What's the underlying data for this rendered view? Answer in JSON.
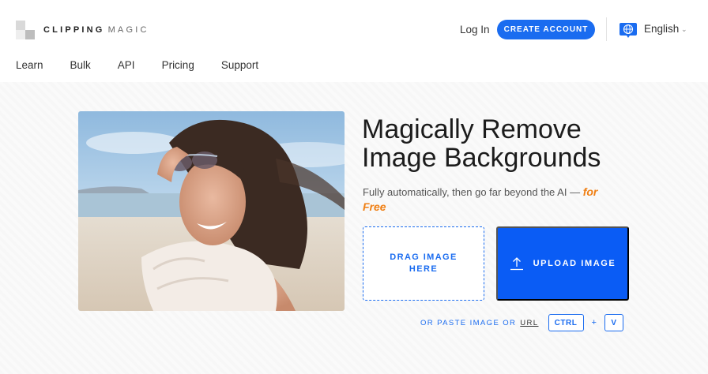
{
  "brand": {
    "name_bold": "CLIPPING",
    "name_light": "MAGIC"
  },
  "header": {
    "login_label": "Log In",
    "create_account_label": "CREATE ACCOUNT",
    "language_label": "English"
  },
  "nav": {
    "items": [
      "Learn",
      "Bulk",
      "API",
      "Pricing",
      "Support"
    ]
  },
  "hero": {
    "headline_line1": "Magically Remove",
    "headline_line2": "Image Backgrounds",
    "subline_text": "Fully automatically, then go far beyond the AI —",
    "subline_free": "for Free",
    "drag_label": "DRAG IMAGE HERE",
    "upload_label": "UPLOAD IMAGE",
    "paste_text": "OR PASTE IMAGE OR",
    "url_label": "URL",
    "key_ctrl": "CTRL",
    "plus": "+",
    "key_v": "V"
  },
  "icons": {
    "globe": "globe-icon",
    "chevron": "chevron-down-icon",
    "upload": "upload-arrow-icon"
  },
  "colors": {
    "accent": "#1a6cf0",
    "upload_bg": "#0a5cf5",
    "free": "#f07f13"
  }
}
